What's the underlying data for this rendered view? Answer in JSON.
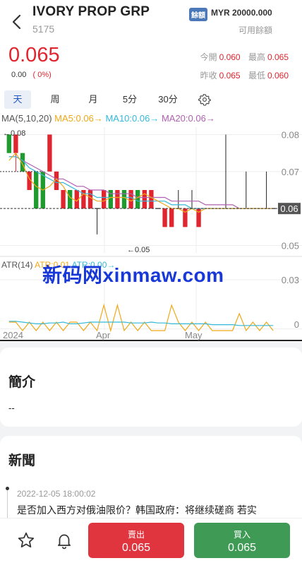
{
  "header": {
    "title": "IVORY PROP GRP",
    "code": "5175",
    "balance_badge": "餘額",
    "balance_value": "MYR 20000.000",
    "balance_label": "可用餘額"
  },
  "quote": {
    "price": "0.065",
    "change": "0.00",
    "change_pct": "( 0%)",
    "open_label": "今開",
    "open": "0.060",
    "high_label": "最高",
    "high": "0.065",
    "prev_close_label": "昨收",
    "prev_close": "0.065",
    "low_label": "最低",
    "low": "0.060"
  },
  "tabs": [
    "天",
    "周",
    "月",
    "5分",
    "30分"
  ],
  "colors": {
    "up": "#e0252f",
    "down": "#1e9a2e",
    "ma5": "#f0a818",
    "ma10": "#35b8d8",
    "ma20": "#b060b0",
    "accent": "#2257c2"
  },
  "chart": {
    "ma_legend": {
      "prefix": "MA(5,10,20)",
      "ma5": "MA5:0.06→",
      "ma10": "MA10:0.06→",
      "ma20": "MA20:0.06→"
    },
    "atr_legend": {
      "prefix": "ATR(14)",
      "a": "ATR:0.01",
      "b": "ATR:0.00→"
    },
    "max_label": "←0.08",
    "min_label": "←0.05",
    "last_price_tag": "0.06",
    "watermark": "新码网xinmaw.com"
  },
  "chart_data": {
    "type": "line",
    "price_axis": {
      "ticks": [
        "0.08",
        "0.07",
        "0.06",
        "0.05"
      ],
      "ylim": [
        0.048,
        0.082
      ]
    },
    "atr_axis": {
      "ticks": [
        "0.03",
        "0"
      ],
      "ylim": [
        0,
        0.035
      ]
    },
    "x_labels": [
      "2024",
      "Apr",
      "May"
    ],
    "candles": [
      {
        "open": 0.075,
        "close": 0.08,
        "high": 0.08,
        "low": 0.075,
        "dir": "down"
      },
      {
        "open": 0.08,
        "close": 0.075,
        "high": 0.08,
        "low": 0.07,
        "dir": "up"
      },
      {
        "open": 0.07,
        "close": 0.075,
        "high": 0.075,
        "low": 0.07,
        "dir": "down"
      },
      {
        "open": 0.065,
        "close": 0.07,
        "high": 0.07,
        "low": 0.065,
        "dir": "up"
      },
      {
        "open": 0.06,
        "close": 0.07,
        "high": 0.07,
        "low": 0.06,
        "dir": "down"
      },
      {
        "open": 0.06,
        "close": 0.07,
        "high": 0.07,
        "low": 0.06,
        "dir": "down"
      },
      {
        "open": 0.08,
        "close": 0.07,
        "high": 0.08,
        "low": 0.07,
        "dir": "up"
      },
      {
        "open": 0.07,
        "close": 0.065,
        "high": 0.07,
        "low": 0.065,
        "dir": "up"
      },
      {
        "open": 0.065,
        "close": 0.06,
        "high": 0.065,
        "low": 0.06,
        "dir": "up"
      },
      {
        "open": 0.06,
        "close": 0.065,
        "high": 0.065,
        "low": 0.06,
        "dir": "down"
      },
      {
        "open": 0.065,
        "close": 0.06,
        "high": 0.065,
        "low": 0.06,
        "dir": "up"
      },
      {
        "open": 0.065,
        "close": 0.06,
        "high": 0.065,
        "low": 0.06,
        "dir": "up"
      },
      {
        "open": 0.065,
        "close": 0.06,
        "high": 0.065,
        "low": 0.06,
        "dir": "up"
      },
      {
        "open": 0.06,
        "close": 0.06,
        "high": 0.06,
        "low": 0.053,
        "dir": "flat"
      },
      {
        "open": 0.065,
        "close": 0.06,
        "high": 0.065,
        "low": 0.06,
        "dir": "up"
      },
      {
        "open": 0.06,
        "close": 0.065,
        "high": 0.065,
        "low": 0.06,
        "dir": "down"
      },
      {
        "open": 0.065,
        "close": 0.06,
        "high": 0.065,
        "low": 0.06,
        "dir": "up"
      },
      {
        "open": 0.06,
        "close": 0.065,
        "high": 0.065,
        "low": 0.06,
        "dir": "down"
      },
      {
        "open": 0.065,
        "close": 0.06,
        "high": 0.065,
        "low": 0.06,
        "dir": "up"
      },
      {
        "open": 0.06,
        "close": 0.065,
        "high": 0.065,
        "low": 0.06,
        "dir": "down"
      },
      {
        "open": 0.065,
        "close": 0.06,
        "high": 0.065,
        "low": 0.06,
        "dir": "up"
      },
      {
        "open": 0.065,
        "close": 0.06,
        "high": 0.065,
        "low": 0.06,
        "dir": "up"
      },
      {
        "open": 0.06,
        "close": 0.06,
        "high": 0.06,
        "low": 0.06,
        "dir": "flat"
      },
      {
        "open": 0.06,
        "close": 0.055,
        "high": 0.06,
        "low": 0.055,
        "dir": "up"
      },
      {
        "open": 0.06,
        "close": 0.055,
        "high": 0.06,
        "low": 0.055,
        "dir": "up"
      },
      {
        "open": 0.06,
        "close": 0.06,
        "high": 0.065,
        "low": 0.06,
        "dir": "flat"
      },
      {
        "open": 0.06,
        "close": 0.055,
        "high": 0.06,
        "low": 0.055,
        "dir": "up"
      },
      {
        "open": 0.06,
        "close": 0.06,
        "high": 0.065,
        "low": 0.06,
        "dir": "flat"
      },
      {
        "open": 0.06,
        "close": 0.055,
        "high": 0.06,
        "low": 0.055,
        "dir": "up"
      },
      {
        "open": 0.06,
        "close": 0.06,
        "high": 0.06,
        "low": 0.06,
        "dir": "flat"
      },
      {
        "open": 0.06,
        "close": 0.06,
        "high": 0.06,
        "low": 0.06,
        "dir": "flat"
      },
      {
        "open": 0.06,
        "close": 0.06,
        "high": 0.06,
        "low": 0.06,
        "dir": "flat"
      },
      {
        "open": 0.06,
        "close": 0.06,
        "high": 0.08,
        "low": 0.06,
        "dir": "flat"
      },
      {
        "open": 0.06,
        "close": 0.06,
        "high": 0.06,
        "low": 0.06,
        "dir": "flat"
      },
      {
        "open": 0.06,
        "close": 0.06,
        "high": 0.06,
        "low": 0.06,
        "dir": "flat"
      },
      {
        "open": 0.06,
        "close": 0.06,
        "high": 0.07,
        "low": 0.06,
        "dir": "flat"
      },
      {
        "open": 0.06,
        "close": 0.06,
        "high": 0.06,
        "low": 0.06,
        "dir": "flat"
      },
      {
        "open": 0.06,
        "close": 0.06,
        "high": 0.06,
        "low": 0.06,
        "dir": "flat"
      },
      {
        "open": 0.06,
        "close": 0.06,
        "high": 0.07,
        "low": 0.06,
        "dir": "flat"
      },
      {
        "open": 0.06,
        "close": 0.06,
        "high": 0.06,
        "low": 0.06,
        "dir": "flat"
      }
    ],
    "ma5": [
      0.073,
      0.075,
      0.072,
      0.068,
      0.066,
      0.065,
      0.066,
      0.068,
      0.066,
      0.063,
      0.062,
      0.064,
      0.063,
      0.062,
      0.062,
      0.063,
      0.063,
      0.063,
      0.062,
      0.063,
      0.064,
      0.063,
      0.062,
      0.061,
      0.06,
      0.06,
      0.059,
      0.06,
      0.059,
      0.06,
      0.06,
      0.06,
      0.06,
      0.06,
      0.06,
      0.06,
      0.06,
      0.06,
      0.06,
      0.06
    ],
    "ma10": [
      0.074,
      0.074,
      0.073,
      0.071,
      0.07,
      0.069,
      0.068,
      0.067,
      0.067,
      0.066,
      0.065,
      0.064,
      0.064,
      0.063,
      0.063,
      0.063,
      0.063,
      0.063,
      0.063,
      0.062,
      0.062,
      0.062,
      0.062,
      0.062,
      0.061,
      0.061,
      0.061,
      0.06,
      0.06,
      0.06,
      0.06,
      0.06,
      0.06,
      0.06,
      0.06,
      0.06,
      0.06,
      0.06,
      0.06,
      0.06
    ],
    "ma20": [
      0.074,
      0.074,
      0.073,
      0.072,
      0.071,
      0.07,
      0.069,
      0.068,
      0.068,
      0.067,
      0.066,
      0.066,
      0.065,
      0.065,
      0.065,
      0.064,
      0.064,
      0.064,
      0.064,
      0.063,
      0.063,
      0.063,
      0.063,
      0.063,
      0.062,
      0.062,
      0.062,
      0.062,
      0.062,
      0.061,
      0.061,
      0.061,
      0.061,
      0.061,
      0.06,
      0.06,
      0.06,
      0.06,
      0.06,
      0.06
    ],
    "atr": [
      0.0055,
      0.0055,
      0.005,
      0.0045,
      0.004,
      0.004,
      0.0045,
      0.0045,
      0.005,
      0.004,
      0.004,
      0.0045,
      0.005,
      0.005,
      0.005,
      0.005,
      0.005,
      0.005,
      0.0045,
      0.0045,
      0.0045,
      0.005,
      0.0045,
      0.0045,
      0.004,
      0.004,
      0.004,
      0.004,
      0.004,
      0.004,
      0.0035,
      0.0035,
      0.0035,
      0.0035,
      0.003,
      0.003,
      0.003,
      0.003,
      0.003,
      0.003
    ],
    "tr": [
      0.005,
      0.005,
      0.0,
      0.005,
      0.0,
      0.005,
      0.0,
      0.005,
      0.0,
      0.005,
      0.005,
      0.0,
      0.005,
      0.0,
      0.015,
      0.0,
      0.015,
      0.0,
      0.005,
      0.0,
      0.005,
      0.0,
      0.0,
      0.0,
      0.015,
      0.005,
      0.0,
      0.005,
      0.0,
      0.005,
      0.0,
      0.0,
      0.0,
      0.0,
      0.01,
      0.0,
      0.005,
      0.0,
      0.005,
      0.0
    ]
  },
  "intro": {
    "title": "簡介",
    "body": "--"
  },
  "news": {
    "title": "新聞",
    "items": [
      {
        "time": "2022-12-05 18:00:02",
        "headline": "是否加入西方对俄油限价？韩国政府：将继续磋商 若实"
      }
    ]
  },
  "bottom_bar": {
    "star_icon": "star-icon",
    "bell_icon": "bell-icon",
    "sell_label": "賣出",
    "sell_price": "0.065",
    "buy_label": "買入",
    "buy_price": "0.065"
  }
}
